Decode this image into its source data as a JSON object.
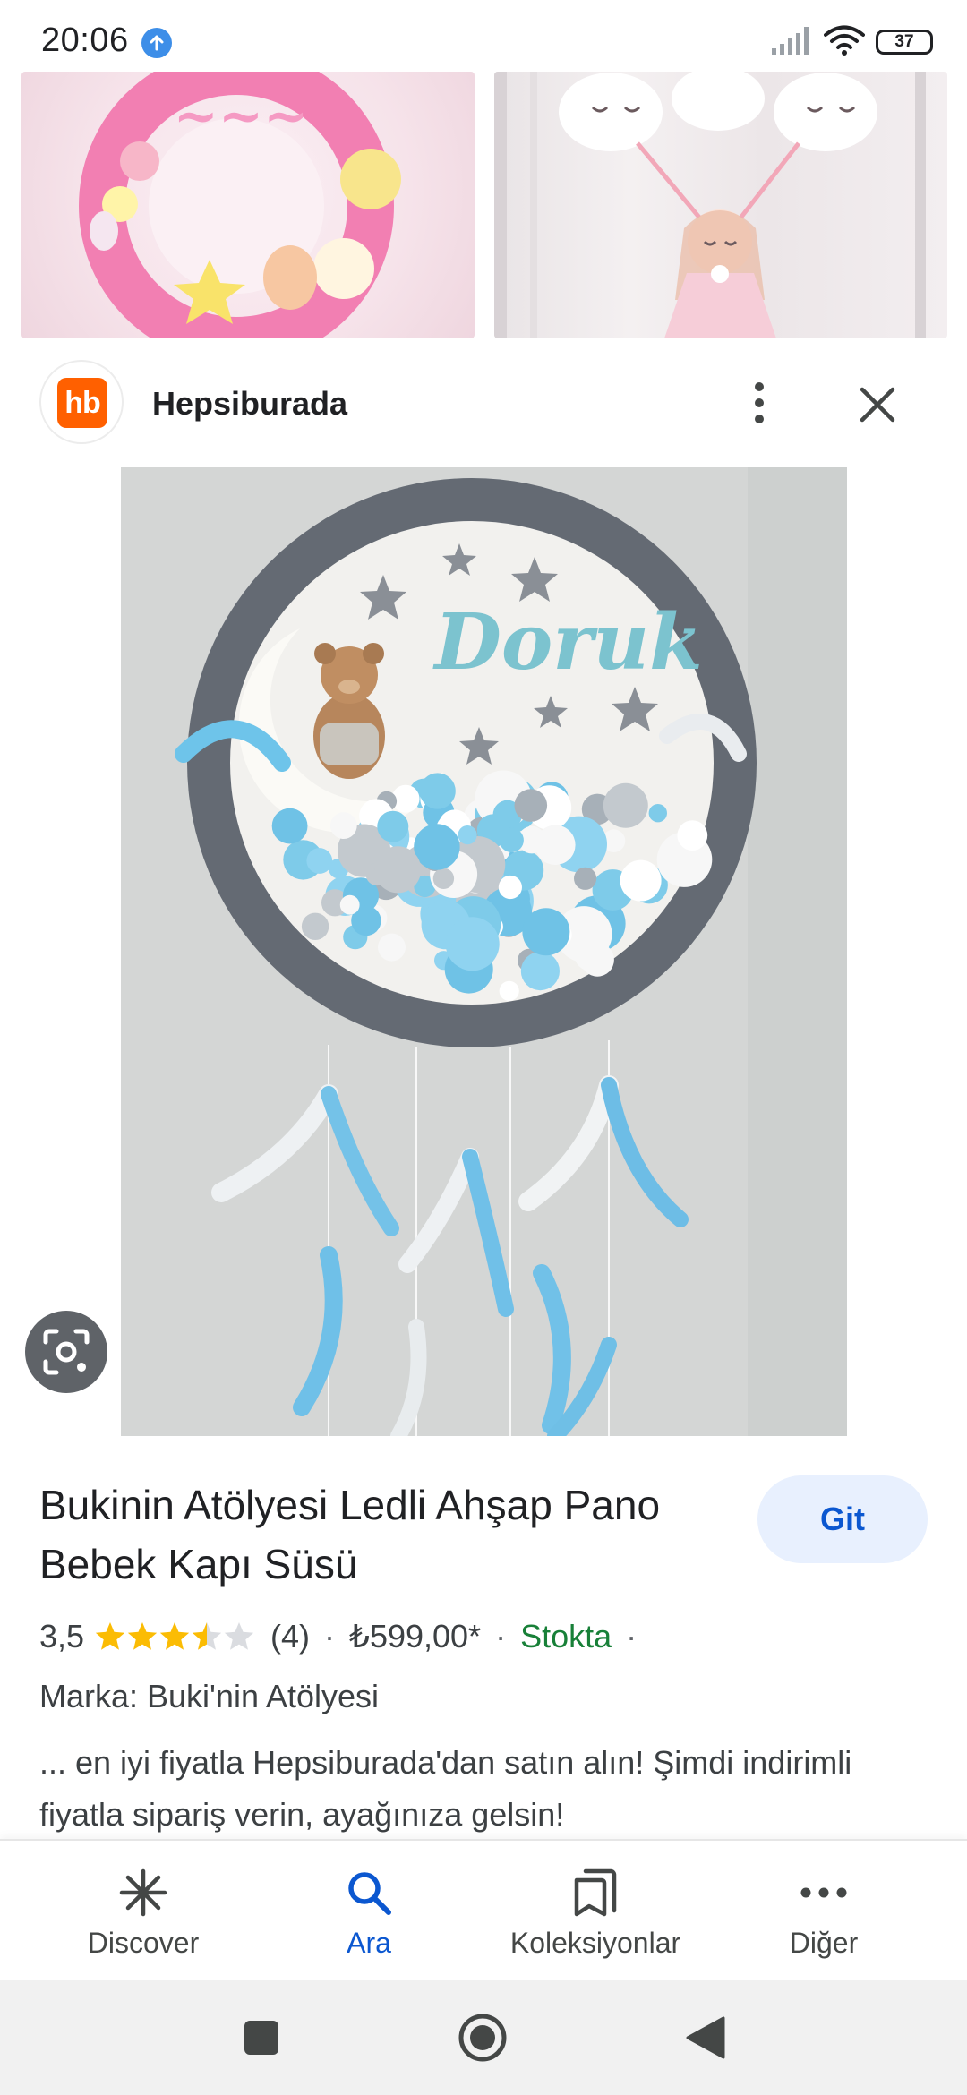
{
  "status_bar": {
    "time": "20:06",
    "battery": "37"
  },
  "source": {
    "logo_text": "hb",
    "name": "Hepsiburada",
    "logo_color": "#ff6000"
  },
  "product": {
    "title": "Bukinin Atölyesi Ledli Ahşap Pano Bebek Kapı Süsü",
    "go_button": "Git",
    "rating": "3,5",
    "rating_value": 3.5,
    "review_count": "(4)",
    "price": "₺599,00*",
    "availability": "Stokta",
    "brand": "Marka: Buki'nin Atölyesi",
    "description": "... en iyi fiyatla Hepsiburada'dan satın alın! Şimdi indirimli fiyatla sipariş verin, ayağınıza gelsin!"
  },
  "main_image": {
    "name_text": "Doruk"
  },
  "bottom_nav": {
    "items": [
      {
        "label": "Discover",
        "icon": "asterisk-icon"
      },
      {
        "label": "Ara",
        "icon": "search-icon",
        "active": true
      },
      {
        "label": "Koleksiyonlar",
        "icon": "bookmarks-icon"
      },
      {
        "label": "Diğer",
        "icon": "more-horizontal-icon"
      }
    ]
  },
  "colors": {
    "accent": "#0b57d0",
    "stock_green": "#188038",
    "star": "#fbbc04",
    "go_button_bg": "#e8f0fe"
  }
}
